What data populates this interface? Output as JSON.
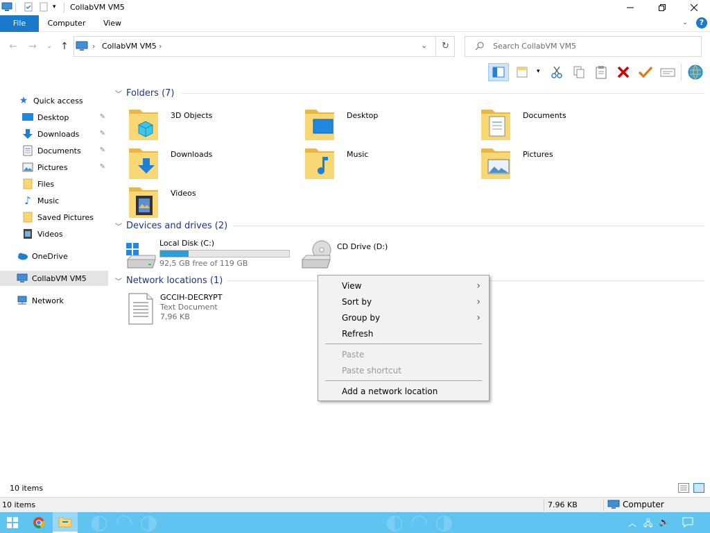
{
  "window": {
    "title": "CollabVM VM5"
  },
  "ribbon": {
    "tabs": [
      "File",
      "Computer",
      "View"
    ]
  },
  "address": {
    "path": "CollabVM VM5"
  },
  "search": {
    "placeholder": "Search CollabVM VM5"
  },
  "sidebar": {
    "quick_access": "Quick access",
    "items": [
      {
        "label": "Desktop",
        "icon": "desktop-icon",
        "pinned": true
      },
      {
        "label": "Downloads",
        "icon": "downloads-icon",
        "pinned": true
      },
      {
        "label": "Documents",
        "icon": "documents-icon",
        "pinned": true
      },
      {
        "label": "Pictures",
        "icon": "pictures-icon",
        "pinned": true
      },
      {
        "label": "Files",
        "icon": "folder-icon",
        "pinned": false
      },
      {
        "label": "Music",
        "icon": "music-icon",
        "pinned": false
      },
      {
        "label": "Saved Pictures",
        "icon": "folder-icon",
        "pinned": false
      },
      {
        "label": "Videos",
        "icon": "videos-icon",
        "pinned": false
      }
    ],
    "onedrive": "OneDrive",
    "this_pc": "CollabVM VM5",
    "network": "Network"
  },
  "content": {
    "folders_header": "Folders (7)",
    "folders": [
      {
        "label": "3D Objects",
        "icon": "3d-objects-icon"
      },
      {
        "label": "Desktop",
        "icon": "desktop-icon"
      },
      {
        "label": "Documents",
        "icon": "documents-icon"
      },
      {
        "label": "Downloads",
        "icon": "downloads-icon"
      },
      {
        "label": "Music",
        "icon": "music-icon"
      },
      {
        "label": "Pictures",
        "icon": "pictures-icon"
      },
      {
        "label": "Videos",
        "icon": "videos-icon"
      }
    ],
    "devices_header": "Devices and drives (2)",
    "drives": [
      {
        "label": "Local Disk (C:)",
        "free": "92,5 GB free of 119 GB",
        "used_fraction": 0.22
      },
      {
        "label": "CD Drive (D:)"
      }
    ],
    "network_header": "Network locations (1)",
    "network_items": [
      {
        "label": "GCCIH-DECRYPT",
        "type": "Text Document",
        "size": "7,96 KB"
      }
    ]
  },
  "context_menu": {
    "items": [
      {
        "label": "View",
        "submenu": true,
        "disabled": false
      },
      {
        "label": "Sort by",
        "submenu": true,
        "disabled": false
      },
      {
        "label": "Group by",
        "submenu": true,
        "disabled": false
      },
      {
        "label": "Refresh",
        "submenu": false,
        "disabled": false
      },
      {
        "label": "Paste",
        "submenu": false,
        "disabled": true
      },
      {
        "label": "Paste shortcut",
        "submenu": false,
        "disabled": true
      },
      {
        "label": "Add a network location",
        "submenu": false,
        "disabled": false
      }
    ]
  },
  "status": {
    "items_count": "10 items",
    "items_count2": "10 items",
    "size": "7.96 KB",
    "location": "Computer"
  },
  "colors": {
    "accent": "#1979ca",
    "group_header": "#1e3287",
    "taskbar": "#5fc4f0",
    "progress": "#26a0da",
    "delete_red": "#d40000",
    "check_orange": "#e07a10"
  }
}
